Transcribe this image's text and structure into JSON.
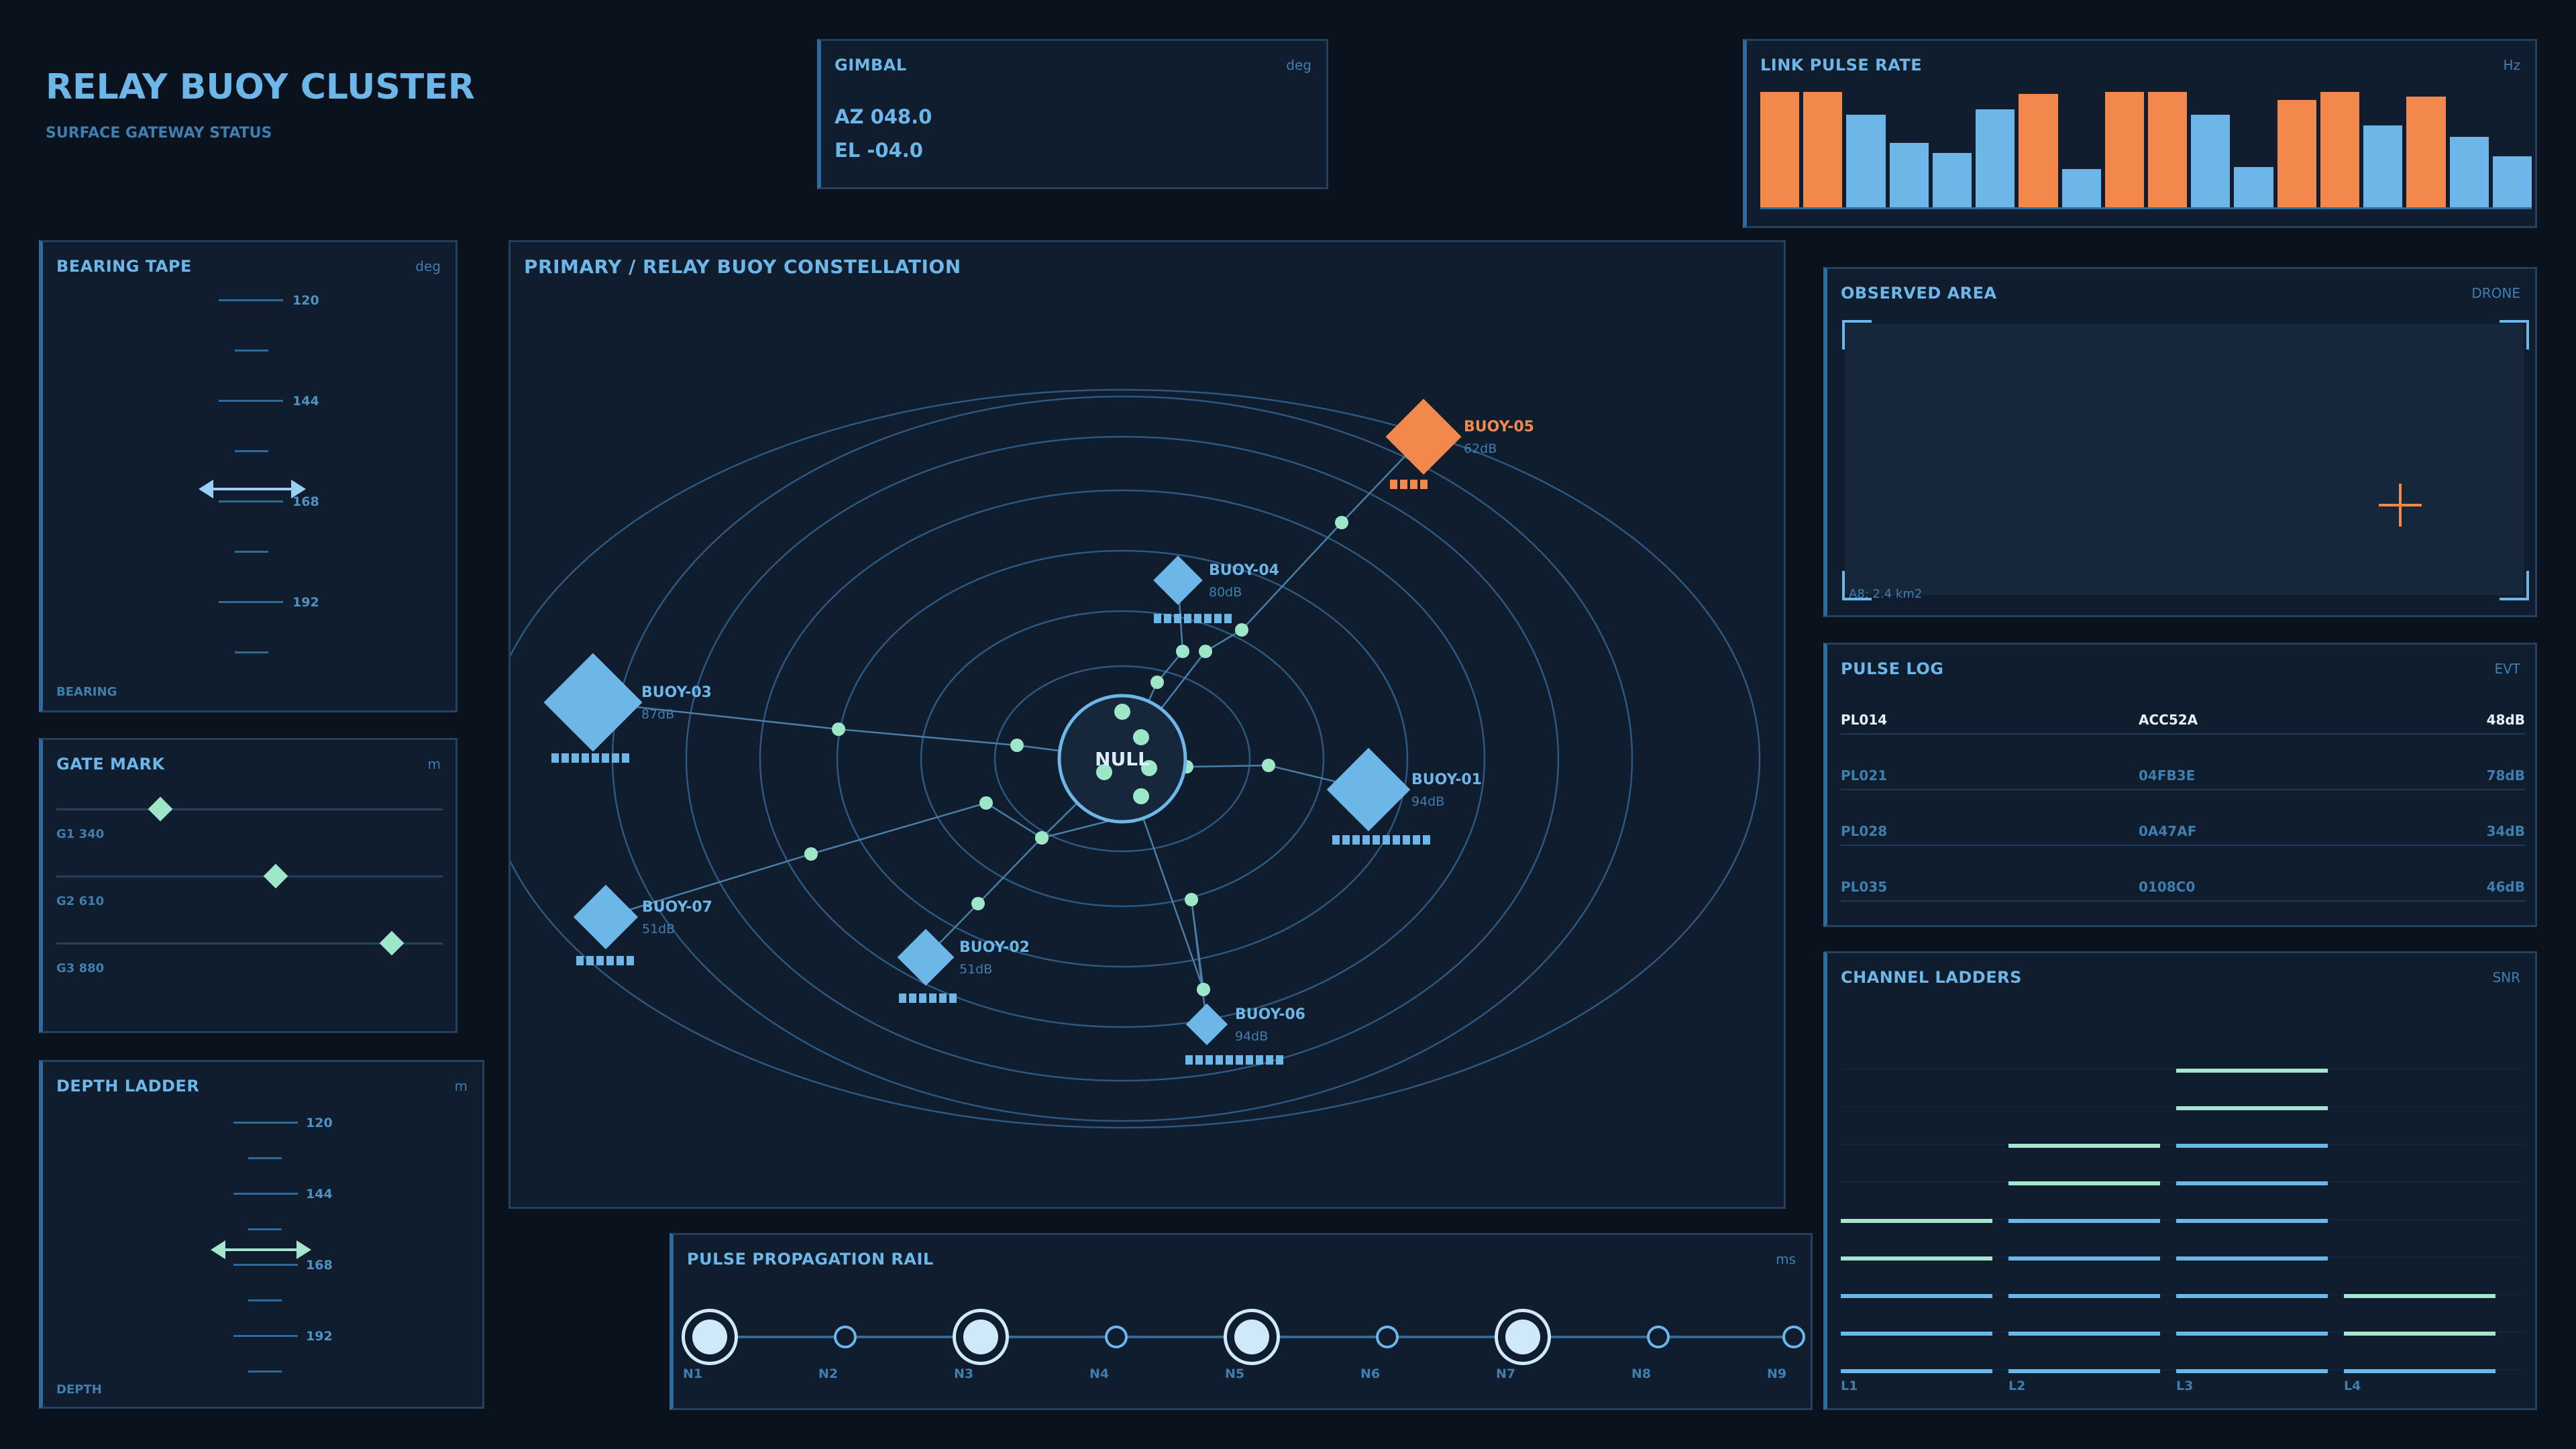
{
  "header": {
    "title": "RELAY BUOY CLUSTER",
    "subtitle": "SURFACE GATEWAY STATUS"
  },
  "gimbal": {
    "title": "GIMBAL",
    "unit": "deg",
    "az": "AZ 048.0",
    "el": "EL -04.0"
  },
  "pulse_rate": {
    "title": "LINK PULSE RATE",
    "unit": "Hz",
    "bars": [
      {
        "level": 1.0,
        "color": "#f2884b"
      },
      {
        "level": 1.0,
        "color": "#f2884b"
      },
      {
        "level": 0.8,
        "color": "#6cb6e8"
      },
      {
        "level": 0.56,
        "color": "#6cb6e8"
      },
      {
        "level": 0.47,
        "color": "#6cb6e8"
      },
      {
        "level": 0.85,
        "color": "#6cb6e8"
      },
      {
        "level": 0.98,
        "color": "#f2884b"
      },
      {
        "level": 0.33,
        "color": "#6cb6e8"
      },
      {
        "level": 1.0,
        "color": "#f2884b"
      },
      {
        "level": 1.0,
        "color": "#f2884b"
      },
      {
        "level": 0.8,
        "color": "#6cb6e8"
      },
      {
        "level": 0.35,
        "color": "#6cb6e8"
      },
      {
        "level": 0.93,
        "color": "#f2884b"
      },
      {
        "level": 1.0,
        "color": "#f2884b"
      },
      {
        "level": 0.71,
        "color": "#6cb6e8"
      },
      {
        "level": 0.96,
        "color": "#f2884b"
      },
      {
        "level": 0.61,
        "color": "#6cb6e8"
      },
      {
        "level": 0.44,
        "color": "#6cb6e8"
      }
    ]
  },
  "bearing": {
    "title": "BEARING TAPE",
    "unit": "deg",
    "ticks": [
      "120",
      "144",
      "168",
      "192"
    ],
    "footer": "BEARING"
  },
  "gate": {
    "title": "GATE MARK",
    "unit": "m",
    "rows": [
      {
        "label": "G1 340",
        "level": 0.27
      },
      {
        "label": "G2 610",
        "level": 0.57
      },
      {
        "label": "G3 880",
        "level": 0.87
      }
    ]
  },
  "depth": {
    "title": "DEPTH LADDER",
    "unit": "m",
    "ticks": [
      "120",
      "144",
      "168",
      "192"
    ],
    "footer": "DEPTH"
  },
  "constellation": {
    "title": "PRIMARY / RELAY BUOY CONSTELLATION",
    "hub": "NULL",
    "buoys": [
      {
        "name": "BUOY-05",
        "db": "62dB",
        "strength": 4,
        "alert": true
      },
      {
        "name": "BUOY-04",
        "db": "80dB",
        "strength": 8,
        "alert": false
      },
      {
        "name": "BUOY-03",
        "db": "87dB",
        "strength": 8,
        "alert": false
      },
      {
        "name": "BUOY-01",
        "db": "94dB",
        "strength": 10,
        "alert": false
      },
      {
        "name": "BUOY-07",
        "db": "51dB",
        "strength": 6,
        "alert": false
      },
      {
        "name": "BUOY-02",
        "db": "51dB",
        "strength": 6,
        "alert": false
      },
      {
        "name": "BUOY-06",
        "db": "94dB",
        "strength": 10,
        "alert": false
      }
    ]
  },
  "observed": {
    "title": "OBSERVED AREA",
    "unit": "DRONE",
    "area": "A8: 2.4 km2"
  },
  "pulse_log": {
    "title": "PULSE LOG",
    "unit": "EVT",
    "rows": [
      {
        "id": "PL014",
        "code": "ACC52A",
        "val": "48dB",
        "active": true
      },
      {
        "id": "PL021",
        "code": "04FB3E",
        "val": "78dB",
        "active": false
      },
      {
        "id": "PL028",
        "code": "0A47AF",
        "val": "34dB",
        "active": false
      },
      {
        "id": "PL035",
        "code": "0108C0",
        "val": "46dB",
        "active": false
      }
    ]
  },
  "ladders": {
    "title": "CHANNEL LADDERS",
    "unit": "SNR",
    "channels": [
      {
        "label": "L1",
        "rungs": 5,
        "green": 2
      },
      {
        "label": "L2",
        "rungs": 7,
        "green": 2
      },
      {
        "label": "L3",
        "rungs": 9,
        "green": 2
      },
      {
        "label": "L4",
        "rungs": 3,
        "green": 2
      }
    ]
  },
  "rail": {
    "title": "PULSE PROPAGATION RAIL",
    "unit": "ms",
    "nodes": [
      {
        "label": "N1",
        "active": true
      },
      {
        "label": "N2",
        "active": false
      },
      {
        "label": "N3",
        "active": true
      },
      {
        "label": "N4",
        "active": false
      },
      {
        "label": "N5",
        "active": true
      },
      {
        "label": "N6",
        "active": false
      },
      {
        "label": "N7",
        "active": true
      },
      {
        "label": "N8",
        "active": false
      },
      {
        "label": "N9",
        "active": false
      }
    ]
  }
}
